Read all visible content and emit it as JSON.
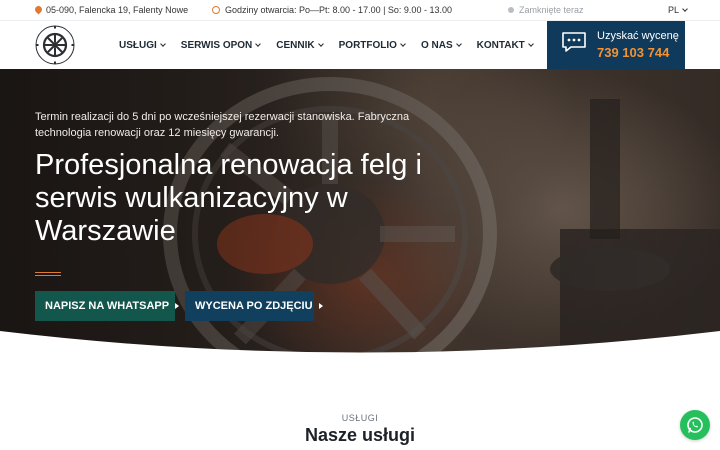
{
  "topbar": {
    "address": "05-090, Falencka 19, Falenty Nowe",
    "hours": "Godziny otwarcia: Po—Pt: 8.00 - 17.00 | So: 9.00 - 13.00",
    "status": "Zamknięte teraz",
    "language": "PL"
  },
  "nav": {
    "items": [
      {
        "label": "USŁUGI"
      },
      {
        "label": "SERWIS OPON"
      },
      {
        "label": "CENNIK"
      },
      {
        "label": "PORTFOLIO"
      },
      {
        "label": "O NAS"
      },
      {
        "label": "KONTAKT"
      }
    ]
  },
  "quote": {
    "label": "Uzyskać wycenę",
    "phone": "739 103 744"
  },
  "hero": {
    "subtitle": "Termin realizacji do 5 dni po wcześniejszej rezerwacji stanowiska. Fabryczna technologia renowacji oraz 12 miesięcy gwarancji.",
    "title": "Profesjonalna renowacja felg i serwis wulkanizacyjny w Warszawie",
    "buttons": {
      "whatsapp": "NAPISZ NA WHATSAPP",
      "photo": "WYCENA PO ZDJĘCIU"
    }
  },
  "services": {
    "kicker": "USŁUGI",
    "title": "Nasze usługi"
  },
  "colors": {
    "accent": "#e07a2e",
    "navy": "#0f3a5c",
    "whatsapp_green": "#25c05b",
    "teal_button": "#12564c"
  },
  "icons": [
    "map-pin-icon",
    "clock-icon",
    "status-dot-icon",
    "chevron-down-icon",
    "chat-bubble-icon",
    "whatsapp-icon",
    "arrow-right-icon"
  ]
}
